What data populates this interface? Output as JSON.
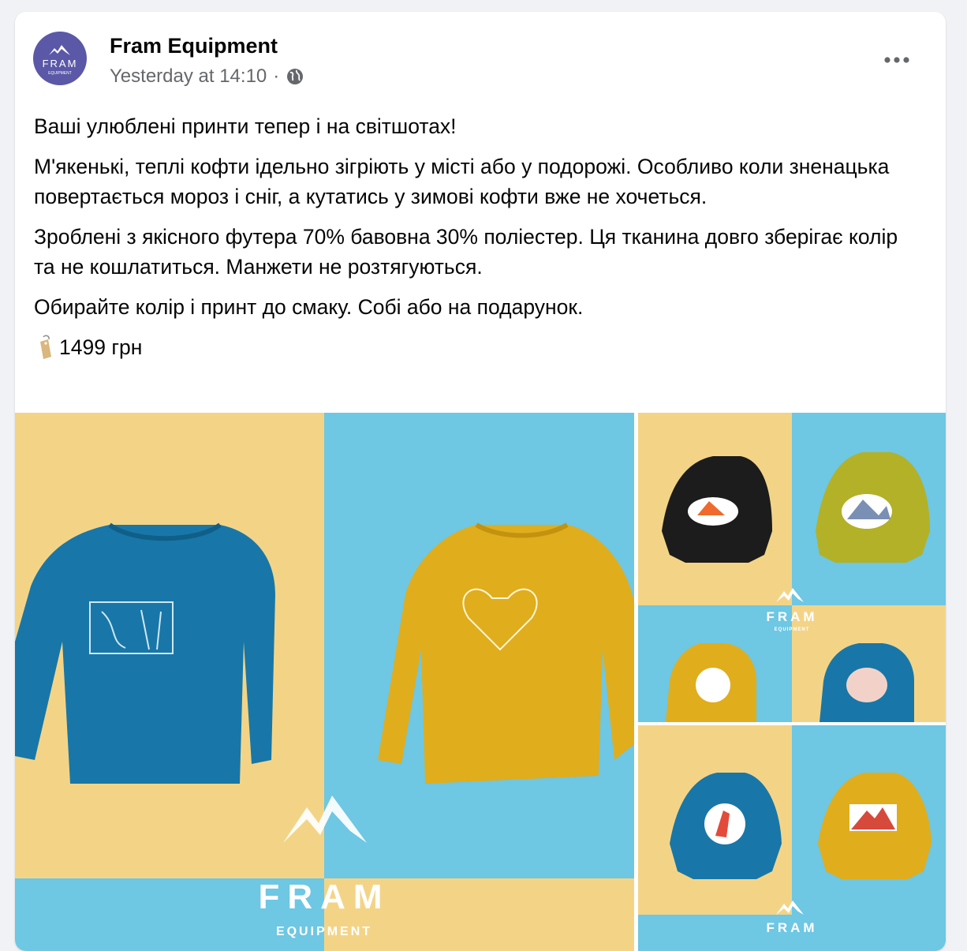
{
  "post": {
    "author": "Fram Equipment",
    "timestamp": "Yesterday at 14:10",
    "separator": "·",
    "privacy_icon": "globe-icon",
    "more_icon": "more-dots-icon",
    "avatar": {
      "brand": "FRAM",
      "sub": "EQUIPMENT",
      "bg_color": "#5a58a7"
    },
    "paragraphs": [
      "Ваші улюблені принти тепер і на світшотах!",
      "М'якенькі, теплі кофти ідельно зігріють у місті або у подорожі. Особливо коли зненацька повертається мороз і сніг, а кутатись у зимові кофти вже не хочеться.",
      "Зроблені з якісного футера 70% бавовна 30% поліестер. Ця тканина довго зберігає колір та не кошлатиться. Манжети не розтягуються.",
      "Обирайте колір і принт до смаку. Собі або на подарунок."
    ],
    "price": "1499 грн",
    "price_icon": "price-tag-icon"
  },
  "gallery": {
    "colors": {
      "yellow_bg": "#f3d487",
      "blue_bg": "#6ec7e3",
      "blue_sweater": "#1877a8",
      "yellow_sweater": "#e0ad1c",
      "black_sweater": "#1c1c1c",
      "olive_sweater": "#b2b128"
    },
    "main_logo": {
      "brand": "FRAM",
      "sub": "EQUIPMENT"
    },
    "r1_logo": {
      "brand": "FRAM",
      "sub": "EQUIPMENT"
    },
    "r2_logo": {
      "brand": "FRAM"
    }
  }
}
